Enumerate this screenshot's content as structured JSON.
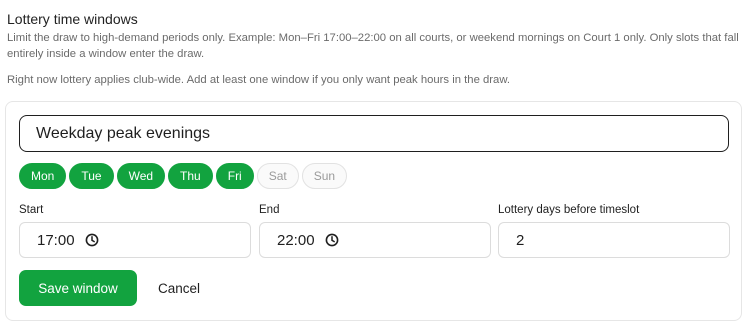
{
  "section": {
    "title": "Lottery time windows",
    "description": "Limit the draw to high-demand periods only. Example: Mon–Fri 17:00–22:00 on all courts, or weekend mornings on Court 1 only. Only slots that fall entirely inside a window enter the draw.",
    "note": "Right now lottery applies club-wide. Add at least one window if you only want peak hours in the draw."
  },
  "form": {
    "name_value": "Weekday peak evenings",
    "days": [
      {
        "label": "Mon",
        "selected": true
      },
      {
        "label": "Tue",
        "selected": true
      },
      {
        "label": "Wed",
        "selected": true
      },
      {
        "label": "Thu",
        "selected": true
      },
      {
        "label": "Fri",
        "selected": true
      },
      {
        "label": "Sat",
        "selected": false
      },
      {
        "label": "Sun",
        "selected": false
      }
    ],
    "start": {
      "label": "Start",
      "value": "17:00",
      "icon": "clock-icon"
    },
    "end": {
      "label": "End",
      "value": "22:00",
      "icon": "clock-icon"
    },
    "lottery_days": {
      "label": "Lottery days before timeslot",
      "value": "2"
    },
    "save_label": "Save window",
    "cancel_label": "Cancel"
  },
  "colors": {
    "accent": "#12a33f",
    "muted_text": "#6b6b6b",
    "border": "#dcdcdc"
  }
}
